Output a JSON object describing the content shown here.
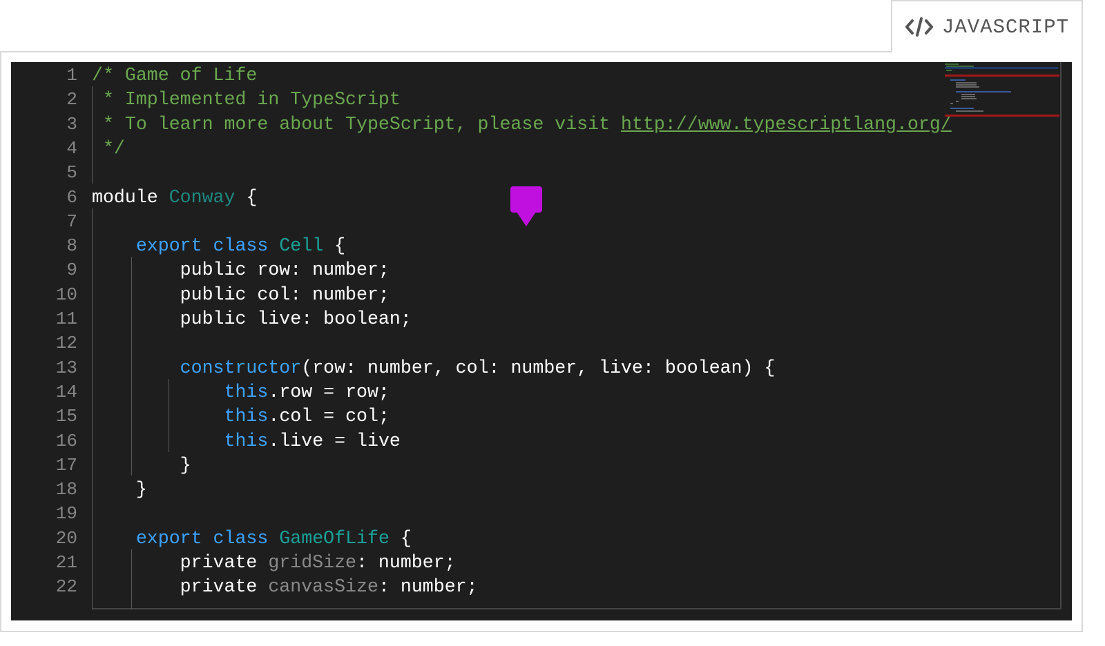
{
  "language_tab": {
    "icon": "code-icon",
    "label": "JAVASCRIPT"
  },
  "editor": {
    "theme_colors": {
      "background": "#1e1e1e",
      "comment": "#6aa84f",
      "keyword": "#3ca3ff",
      "type": "#19a299",
      "plain": "#ffffff",
      "private_member": "#8a8a8a",
      "line_number": "#858585",
      "marker": "#c010e0"
    },
    "lines": [
      {
        "num": "1",
        "tokens": [
          {
            "t": "/* Game of Life",
            "c": "cm"
          }
        ]
      },
      {
        "num": "2",
        "tokens": [
          {
            "t": " * Implemented in TypeScript",
            "c": "cm"
          }
        ]
      },
      {
        "num": "3",
        "tokens": [
          {
            "t": " * To learn more about TypeScript, please visit ",
            "c": "cm"
          },
          {
            "t": "http://www.typescriptlang.org/",
            "c": "link"
          }
        ]
      },
      {
        "num": "4",
        "tokens": [
          {
            "t": " */",
            "c": "cm"
          }
        ]
      },
      {
        "num": "5",
        "tokens": []
      },
      {
        "num": "6",
        "tokens": [
          {
            "t": "module ",
            "c": "pl"
          },
          {
            "t": "Conway",
            "c": "mod"
          },
          {
            "t": " {",
            "c": "pl"
          }
        ]
      },
      {
        "num": "7",
        "tokens": []
      },
      {
        "num": "8",
        "tokens": [
          {
            "t": "    ",
            "c": "pl"
          },
          {
            "t": "export class ",
            "c": "kw"
          },
          {
            "t": "Cell",
            "c": "ty"
          },
          {
            "t": " {",
            "c": "pl"
          }
        ]
      },
      {
        "num": "9",
        "tokens": [
          {
            "t": "        public row: number;",
            "c": "pl"
          }
        ]
      },
      {
        "num": "10",
        "tokens": [
          {
            "t": "        public col: number;",
            "c": "pl"
          }
        ]
      },
      {
        "num": "11",
        "tokens": [
          {
            "t": "        public live: boolean;",
            "c": "pl"
          }
        ]
      },
      {
        "num": "12",
        "tokens": []
      },
      {
        "num": "13",
        "tokens": [
          {
            "t": "        ",
            "c": "pl"
          },
          {
            "t": "constructor",
            "c": "kw"
          },
          {
            "t": "(row: number, col: number, live: boolean) {",
            "c": "pl"
          }
        ]
      },
      {
        "num": "14",
        "tokens": [
          {
            "t": "            ",
            "c": "pl"
          },
          {
            "t": "this",
            "c": "kw"
          },
          {
            "t": ".row = row;",
            "c": "pl"
          }
        ]
      },
      {
        "num": "15",
        "tokens": [
          {
            "t": "            ",
            "c": "pl"
          },
          {
            "t": "this",
            "c": "kw"
          },
          {
            "t": ".col = col;",
            "c": "pl"
          }
        ]
      },
      {
        "num": "16",
        "tokens": [
          {
            "t": "            ",
            "c": "pl"
          },
          {
            "t": "this",
            "c": "kw"
          },
          {
            "t": ".live = live",
            "c": "pl"
          }
        ]
      },
      {
        "num": "17",
        "tokens": [
          {
            "t": "        }",
            "c": "pl"
          }
        ]
      },
      {
        "num": "18",
        "tokens": [
          {
            "t": "    }",
            "c": "pl"
          }
        ]
      },
      {
        "num": "19",
        "tokens": []
      },
      {
        "num": "20",
        "tokens": [
          {
            "t": "    ",
            "c": "pl"
          },
          {
            "t": "export class ",
            "c": "kw"
          },
          {
            "t": "GameOfLife",
            "c": "ty"
          },
          {
            "t": " {",
            "c": "pl"
          }
        ]
      },
      {
        "num": "21",
        "tokens": [
          {
            "t": "        private ",
            "c": "pl"
          },
          {
            "t": "gridSize",
            "c": "pv"
          },
          {
            "t": ": number;",
            "c": "pl"
          }
        ]
      },
      {
        "num": "22",
        "tokens": [
          {
            "t": "        private ",
            "c": "pl"
          },
          {
            "t": "canvasSize",
            "c": "pv"
          },
          {
            "t": ": number;",
            "c": "pl"
          }
        ]
      }
    ],
    "marker_icon": "comment-marker-icon",
    "minimap_icon": "minimap-preview"
  }
}
